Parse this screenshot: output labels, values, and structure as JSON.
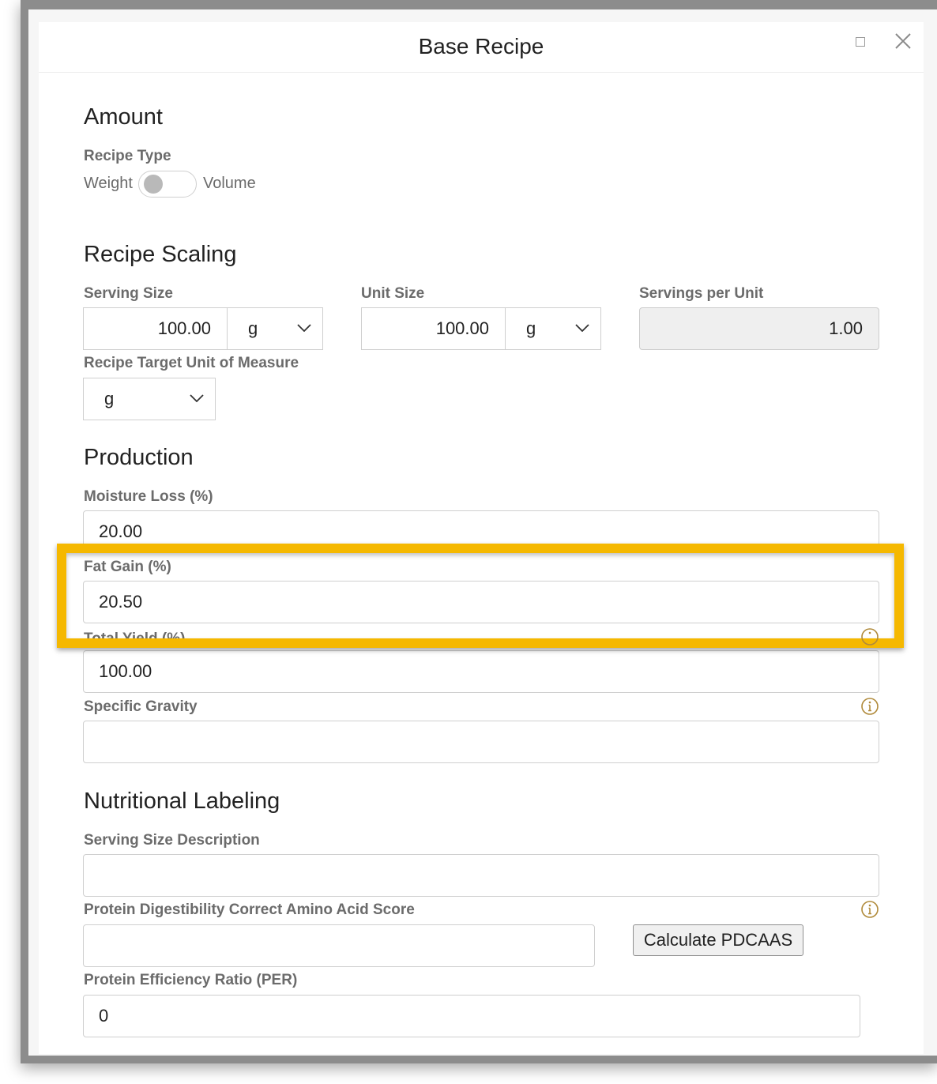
{
  "dialog": {
    "title": "Base Recipe"
  },
  "amount": {
    "section_title": "Amount",
    "recipe_type_label": "Recipe Type",
    "toggle_left": "Weight",
    "toggle_right": "Volume"
  },
  "scaling": {
    "section_title": "Recipe Scaling",
    "serving_size_label": "Serving Size",
    "serving_size_value": "100.00",
    "serving_size_unit": "g",
    "unit_size_label": "Unit Size",
    "unit_size_value": "100.00",
    "unit_size_unit": "g",
    "servings_per_unit_label": "Servings per Unit",
    "servings_per_unit_value": "1.00",
    "target_uom_label": "Recipe Target Unit of Measure",
    "target_uom_value": "g"
  },
  "production": {
    "section_title": "Production",
    "moisture_loss_label": "Moisture Loss (%)",
    "moisture_loss_value": "20.00",
    "fat_gain_label": "Fat Gain (%)",
    "fat_gain_value": "20.50",
    "total_yield_label": "Total Yield (%)",
    "total_yield_value": "100.00",
    "specific_gravity_label": "Specific Gravity",
    "specific_gravity_value": ""
  },
  "nutrition": {
    "section_title": "Nutritional Labeling",
    "serving_desc_label": "Serving Size Description",
    "serving_desc_value": "",
    "pdcaas_label": "Protein Digestibility Correct Amino Acid Score",
    "pdcaas_value": "",
    "pdcaas_button": "Calculate PDCAAS",
    "per_label": "Protein Efficiency Ratio (PER)",
    "per_value": "0"
  },
  "colors": {
    "highlight": "#f5b800",
    "label_gray": "#6b6b6b",
    "readonly_bg": "#efefef"
  }
}
